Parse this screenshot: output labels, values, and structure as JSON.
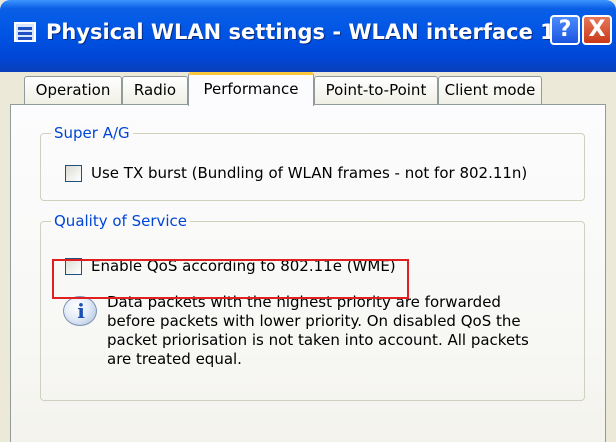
{
  "window": {
    "title": "Physical WLAN settings - WLAN interface 1",
    "help_glyph": "?",
    "close_glyph": "X"
  },
  "tabs": [
    {
      "label": "Operation",
      "active": false
    },
    {
      "label": "Radio",
      "active": false
    },
    {
      "label": "Performance",
      "active": true
    },
    {
      "label": "Point-to-Point",
      "active": false
    },
    {
      "label": "Client mode",
      "active": false
    }
  ],
  "super_ag": {
    "title": "Super A/G",
    "tx_burst": {
      "label": "Use TX burst (Bundling of WLAN frames - not for 802.11n)",
      "checked": false
    }
  },
  "qos": {
    "title": "Quality of Service",
    "enable_qos": {
      "label": "Enable QoS according to 802.11e (WME)",
      "checked": false
    },
    "info_icon": "info-icon",
    "info_glyph": "i",
    "info_lines": [
      "Data packets with the highest priority are forwarded",
      "before packets with lower priority. On disabled QoS the",
      "packet priorisation is not taken into account. All packets",
      "are treated equal."
    ]
  },
  "colors": {
    "titlebar": "#0055e5",
    "group_title": "#0046d5",
    "active_tab_accent": "#ffc83c",
    "highlight": "#e02020"
  }
}
